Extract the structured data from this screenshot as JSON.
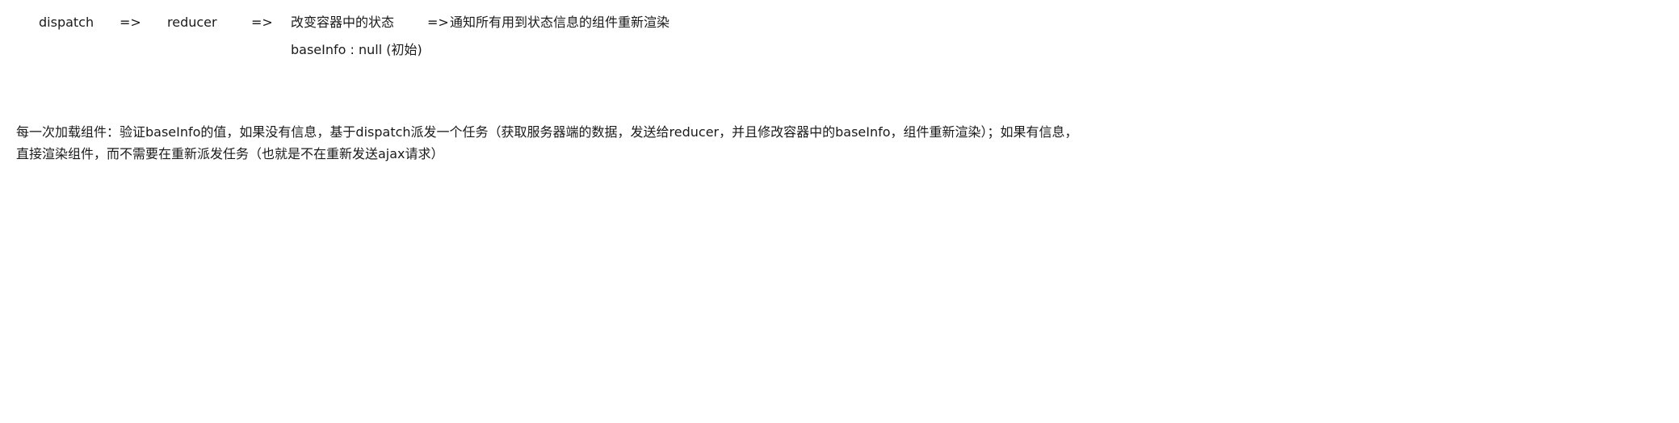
{
  "flow": {
    "step_dispatch": "dispatch",
    "arrow_1": "=>",
    "step_reducer": "reducer",
    "arrow_2": "=>",
    "step_change_state": "改变容器中的状态",
    "arrow_3": "=>",
    "step_notify": "通知所有用到状态信息的组件重新渲染"
  },
  "note": {
    "initial_state": "baseInfo : null  (初始)"
  },
  "description": {
    "line_1": "每一次加载组件：验证baseInfo的值，如果没有信息，基于dispatch派发一个任务（获取服务器端的数据，发送给reducer，并且修改容器中的baseInfo，组件重新渲染）；如果有信息，",
    "line_2": "直接渲染组件，而不需要在重新派发任务（也就是不在重新发送ajax请求）"
  }
}
